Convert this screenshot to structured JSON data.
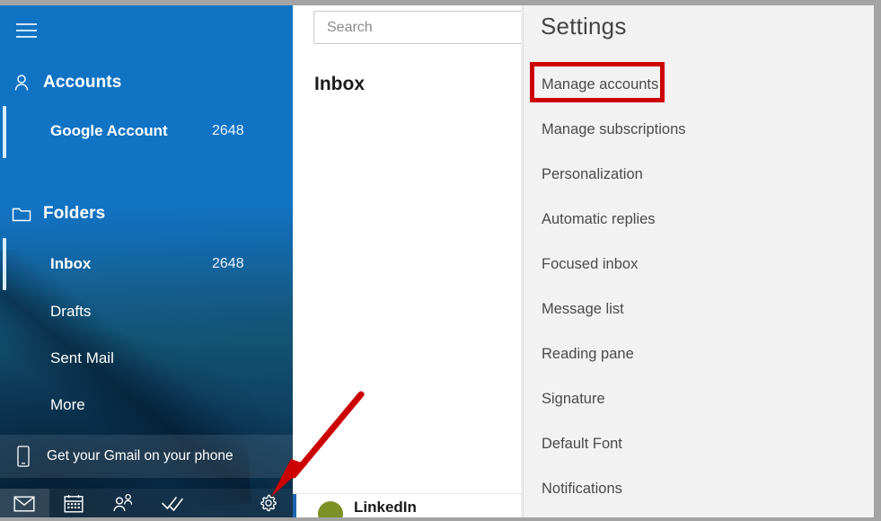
{
  "nav": {
    "menu_icon": "hamburger-menu-icon",
    "sections": [
      {
        "icon": "person-icon",
        "label": "Accounts"
      },
      {
        "icon": "folder-icon",
        "label": "Folders"
      }
    ],
    "accounts": [
      {
        "label": "Google Account",
        "count": "2648"
      }
    ],
    "folders": [
      {
        "label": "Inbox",
        "count": "2648",
        "selected": true
      },
      {
        "label": "Drafts",
        "count": ""
      },
      {
        "label": "Sent Mail",
        "count": ""
      },
      {
        "label": "More",
        "count": ""
      }
    ],
    "promo": {
      "icon": "phone-icon",
      "label": "Get your Gmail on your phone"
    },
    "tabs": [
      {
        "icon": "mail-icon",
        "name": "mail",
        "selected": true
      },
      {
        "icon": "calendar-icon",
        "name": "calendar",
        "selected": false
      },
      {
        "icon": "people-icon",
        "name": "people",
        "selected": false
      },
      {
        "icon": "tasks-icon",
        "name": "tasks",
        "selected": false
      },
      {
        "icon": "gear-icon",
        "name": "settings",
        "selected": false
      }
    ]
  },
  "list": {
    "search_placeholder": "Search",
    "search_value": "",
    "title": "Inbox",
    "messages": [
      {
        "sender": "LinkedIn"
      }
    ]
  },
  "settings": {
    "title": "Settings",
    "items": [
      {
        "label": "Manage accounts",
        "highlighted": true
      },
      {
        "label": "Manage subscriptions",
        "highlighted": false
      },
      {
        "label": "Personalization",
        "highlighted": false
      },
      {
        "label": "Automatic replies",
        "highlighted": false
      },
      {
        "label": "Focused inbox",
        "highlighted": false
      },
      {
        "label": "Message list",
        "highlighted": false
      },
      {
        "label": "Reading pane",
        "highlighted": false
      },
      {
        "label": "Signature",
        "highlighted": false
      },
      {
        "label": "Default Font",
        "highlighted": false
      },
      {
        "label": "Notifications",
        "highlighted": false
      }
    ]
  },
  "annotations": {
    "highlight_color": "#cc0000",
    "arrow_color": "#cc0000",
    "arrow_target": "gear-icon"
  },
  "colors": {
    "nav_blue": "#1173c4",
    "settings_bg": "#f2f2f2",
    "frame_border": "#a3a3a3",
    "avatar": "#7e9126"
  }
}
